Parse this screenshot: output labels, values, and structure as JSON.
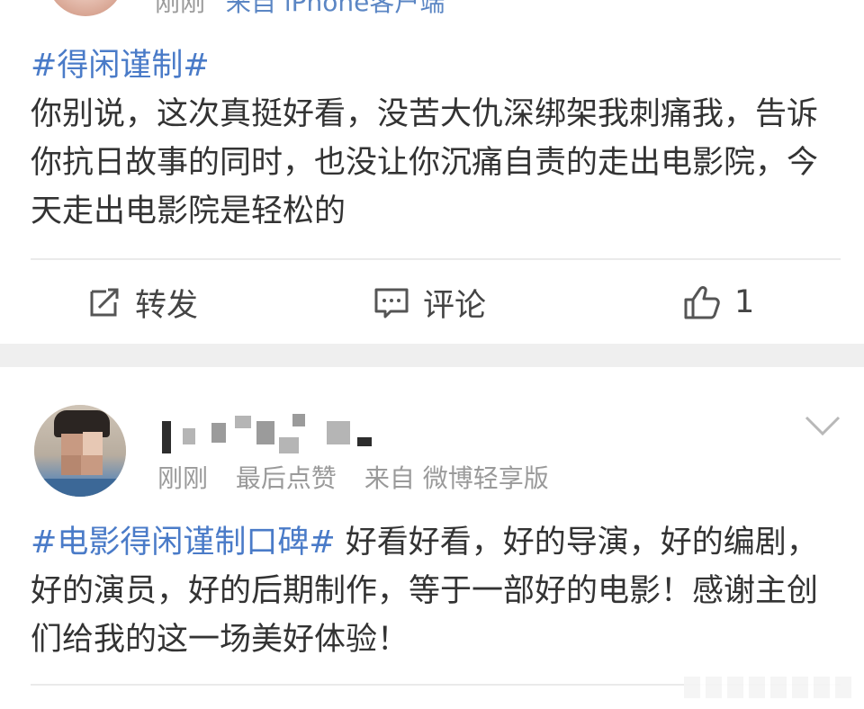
{
  "post1": {
    "meta": {
      "time": "刚刚",
      "source": "来自 iPhone客户端"
    },
    "topic": "#得闲谨制#",
    "text": "你别说，这次真挺好看，没苦大仇深绑架我刺痛我，告诉你抗日故事的同时，也没让你沉痛自责的走出电影院，今天走出电影院是轻松的",
    "actions": {
      "repost_label": "转发",
      "comment_label": "评论",
      "like_count": "1"
    }
  },
  "post2": {
    "meta": {
      "time": "刚刚",
      "liked": "最后点赞",
      "source": "来自 微博轻享版"
    },
    "topic": "#电影得闲谨制口碑#",
    "text": " 好看好看，好的导演，好的编剧，好的演员，好的后期制作，等于一部好的电影！感谢主创们给我的这一场美好体验！"
  },
  "colors": {
    "link": "#4a7bc8",
    "meta": "#9a9a9a",
    "separator": "#efefef"
  },
  "icons": [
    "repost-icon",
    "comment-icon",
    "like-icon",
    "chevron-down-icon"
  ]
}
